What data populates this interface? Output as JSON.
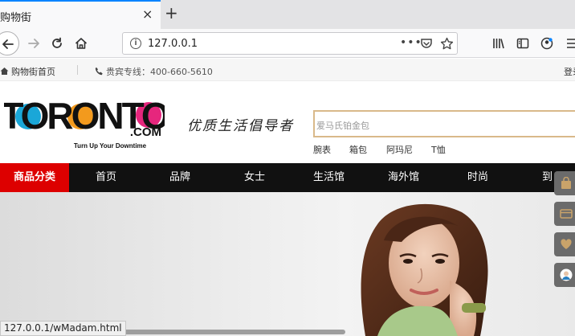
{
  "browser": {
    "tab_title": "购物街",
    "tab_close": "×",
    "new_tab": "+",
    "url": "127.0.0.1",
    "url_more": "•••",
    "status_url": "127.0.0.1/wMadam.html"
  },
  "topbar": {
    "home_link": "购物街首页",
    "hotline": "贵宾专线：400-660-5610",
    "login": "登录"
  },
  "header": {
    "logo_main": "TORONTO",
    "logo_com": ".COM",
    "logo_tagline": "Turn Up Your Downtime",
    "slogan": "优质生活倡导者",
    "search_placeholder": "爱马氏铂金包",
    "hot_words": [
      "腕表",
      "箱包",
      "阿玛尼",
      "T恤"
    ]
  },
  "nav": {
    "category_button": "商品分类",
    "items": [
      "首页",
      "品牌",
      "女士",
      "生活馆",
      "海外馆",
      "时尚",
      "到"
    ]
  },
  "side_tools": [
    "bag-icon",
    "card-icon",
    "heart-icon",
    "avatar-icon"
  ],
  "colors": {
    "nav_bg": "#111111",
    "category_red": "#dd0000",
    "search_border": "#d9b98a",
    "logo_blue": "#1aa7d8",
    "logo_orange": "#f39a1d",
    "logo_pink": "#e6267d",
    "tab_accent": "#0a84ff"
  }
}
